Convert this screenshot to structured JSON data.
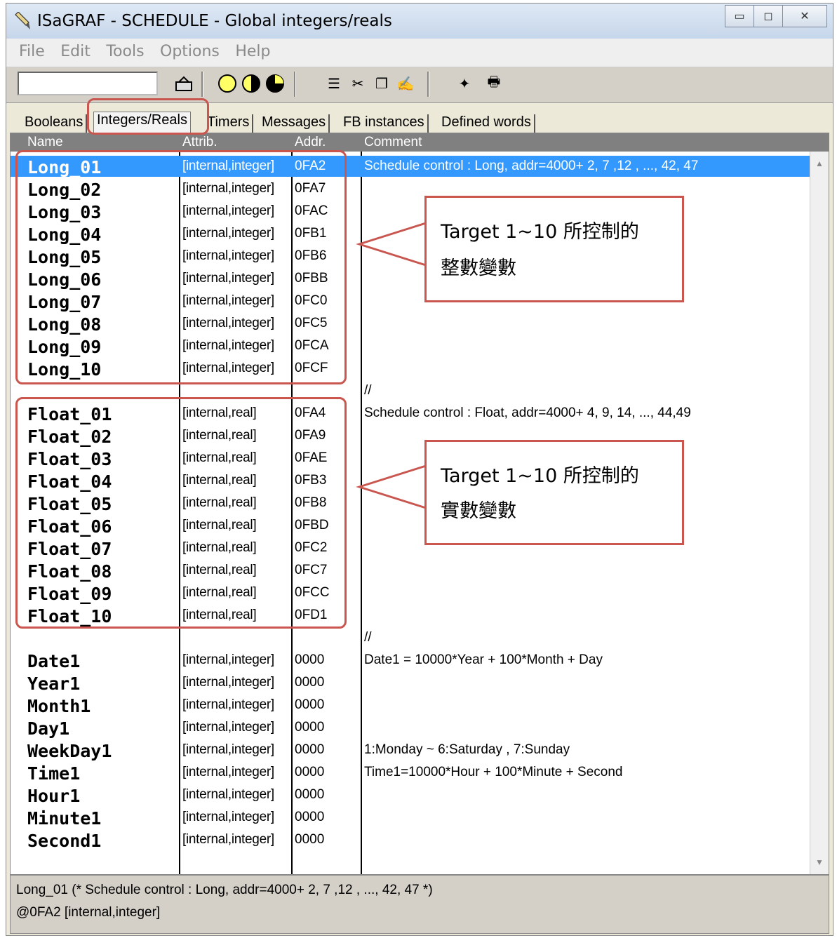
{
  "window": {
    "title": "ISaGRAF - SCHEDULE - Global integers/reals"
  },
  "menu": [
    "File",
    "Edit",
    "Tools",
    "Options",
    "Help"
  ],
  "tabs": [
    "Booleans",
    "Integers/Reals",
    "Timers",
    "Messages",
    "FB instances",
    "Defined words"
  ],
  "columns": {
    "name": "Name",
    "attrib": "Attrib.",
    "addr": "Addr.",
    "comment": "Comment"
  },
  "rows": [
    {
      "name": "Long_01",
      "attr": "[internal,integer]",
      "addr": "0FA2",
      "comment": "Schedule control : Long, addr=4000+ 2, 7 ,12 , ..., 42, 47"
    },
    {
      "name": "Long_02",
      "attr": "[internal,integer]",
      "addr": "0FA7",
      "comment": ""
    },
    {
      "name": "Long_03",
      "attr": "[internal,integer]",
      "addr": "0FAC",
      "comment": ""
    },
    {
      "name": "Long_04",
      "attr": "[internal,integer]",
      "addr": "0FB1",
      "comment": ""
    },
    {
      "name": "Long_05",
      "attr": "[internal,integer]",
      "addr": "0FB6",
      "comment": ""
    },
    {
      "name": "Long_06",
      "attr": "[internal,integer]",
      "addr": "0FBB",
      "comment": ""
    },
    {
      "name": "Long_07",
      "attr": "[internal,integer]",
      "addr": "0FC0",
      "comment": ""
    },
    {
      "name": "Long_08",
      "attr": "[internal,integer]",
      "addr": "0FC5",
      "comment": ""
    },
    {
      "name": "Long_09",
      "attr": "[internal,integer]",
      "addr": "0FCA",
      "comment": ""
    },
    {
      "name": "Long_10",
      "attr": "[internal,integer]",
      "addr": "0FCF",
      "comment": ""
    },
    {
      "name": "",
      "attr": "",
      "addr": "",
      "comment": "//"
    },
    {
      "name": "Float_01",
      "attr": "[internal,real]",
      "addr": "0FA4",
      "comment": "Schedule control : Float, addr=4000+ 4, 9, 14, ..., 44,49"
    },
    {
      "name": "Float_02",
      "attr": "[internal,real]",
      "addr": "0FA9",
      "comment": ""
    },
    {
      "name": "Float_03",
      "attr": "[internal,real]",
      "addr": "0FAE",
      "comment": ""
    },
    {
      "name": "Float_04",
      "attr": "[internal,real]",
      "addr": "0FB3",
      "comment": ""
    },
    {
      "name": "Float_05",
      "attr": "[internal,real]",
      "addr": "0FB8",
      "comment": ""
    },
    {
      "name": "Float_06",
      "attr": "[internal,real]",
      "addr": "0FBD",
      "comment": ""
    },
    {
      "name": "Float_07",
      "attr": "[internal,real]",
      "addr": "0FC2",
      "comment": ""
    },
    {
      "name": "Float_08",
      "attr": "[internal,real]",
      "addr": "0FC7",
      "comment": ""
    },
    {
      "name": "Float_09",
      "attr": "[internal,real]",
      "addr": "0FCC",
      "comment": ""
    },
    {
      "name": "Float_10",
      "attr": "[internal,real]",
      "addr": "0FD1",
      "comment": ""
    },
    {
      "name": "",
      "attr": "",
      "addr": "",
      "comment": "//"
    },
    {
      "name": "Date1",
      "attr": "[internal,integer]",
      "addr": "0000",
      "comment": "Date1 = 10000*Year + 100*Month + Day"
    },
    {
      "name": "Year1",
      "attr": "[internal,integer]",
      "addr": "0000",
      "comment": ""
    },
    {
      "name": "Month1",
      "attr": "[internal,integer]",
      "addr": "0000",
      "comment": ""
    },
    {
      "name": "Day1",
      "attr": "[internal,integer]",
      "addr": "0000",
      "comment": ""
    },
    {
      "name": "WeekDay1",
      "attr": "[internal,integer]",
      "addr": "0000",
      "comment": "1:Monday  ~  6:Saturday , 7:Sunday"
    },
    {
      "name": "Time1",
      "attr": "[internal,integer]",
      "addr": "0000",
      "comment": "Time1=10000*Hour + 100*Minute + Second"
    },
    {
      "name": "Hour1",
      "attr": "[internal,integer]",
      "addr": "0000",
      "comment": ""
    },
    {
      "name": "Minute1",
      "attr": "[internal,integer]",
      "addr": "0000",
      "comment": ""
    },
    {
      "name": "Second1",
      "attr": "[internal,integer]",
      "addr": "0000",
      "comment": ""
    }
  ],
  "status": {
    "line1": "Long_01   (* Schedule control : Long, addr=4000+ 2, 7 ,12 , ..., 42, 47 *)",
    "line2": "@0FA2   [internal,integer]"
  },
  "callouts": {
    "integers": {
      "line1": "Target 1~10  所控制的",
      "line2": "整數變數"
    },
    "reals": {
      "line1": "Target 1~10  所控制的",
      "line2": "實數變數"
    }
  },
  "colors": {
    "highlight": "#c9564f",
    "selection": "#3399ff",
    "header": "#808080"
  }
}
